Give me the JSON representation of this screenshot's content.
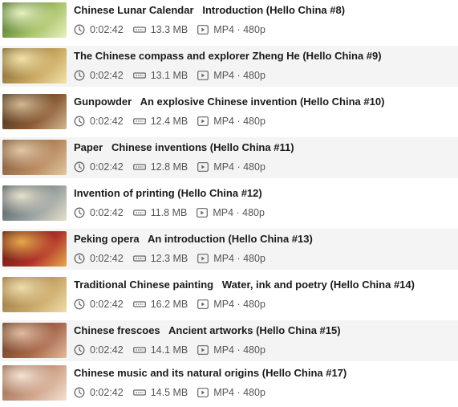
{
  "videos": [
    {
      "title": "Chinese Lunar Calendar   Introduction (Hello China #8)",
      "duration": "0:02:42",
      "size": "13.3 MB",
      "format": "MP4 · 480p",
      "thumb": {
        "c1": "#2f5a1e",
        "c2": "#a9c46a",
        "c3": "#e8f0c0"
      }
    },
    {
      "title": "The Chinese compass and explorer Zheng He (Hello China #9)",
      "duration": "0:02:42",
      "size": "13.1 MB",
      "format": "MP4 · 480p",
      "thumb": {
        "c1": "#6a5228",
        "c2": "#c9a860",
        "c3": "#f2e2a8"
      }
    },
    {
      "title": "Gunpowder   An explosive Chinese invention (Hello China #10)",
      "duration": "0:02:42",
      "size": "12.4 MB",
      "format": "MP4 · 480p",
      "thumb": {
        "c1": "#3a2a1c",
        "c2": "#8a5a34",
        "c3": "#d2b890"
      }
    },
    {
      "title": "Paper   Chinese inventions (Hello China #11)",
      "duration": "0:02:42",
      "size": "12.8 MB",
      "format": "MP4 · 480p",
      "thumb": {
        "c1": "#6b4a30",
        "c2": "#b88960",
        "c3": "#e0c7a2"
      }
    },
    {
      "title": "Invention of printing (Hello China #12)",
      "duration": "0:02:42",
      "size": "11.8 MB",
      "format": "MP4 · 480p",
      "thumb": {
        "c1": "#3d4a55",
        "c2": "#9aa2a0",
        "c3": "#e6e0cc"
      }
    },
    {
      "title": "Peking opera   An introduction (Hello China #13)",
      "duration": "0:02:42",
      "size": "12.3 MB",
      "format": "MP4 · 480p",
      "thumb": {
        "c1": "#4a1410",
        "c2": "#b0322a",
        "c3": "#e8a84c"
      }
    },
    {
      "title": "Traditional Chinese painting   Water, ink and poetry (Hello China #14)",
      "duration": "0:02:42",
      "size": "16.2 MB",
      "format": "MP4 · 480p",
      "thumb": {
        "c1": "#8a6a3a",
        "c2": "#c8a868",
        "c3": "#efdcaa"
      }
    },
    {
      "title": "Chinese frescoes   Ancient artworks (Hello China #15)",
      "duration": "0:02:42",
      "size": "14.1 MB",
      "format": "MP4 · 480p",
      "thumb": {
        "c1": "#5a3020",
        "c2": "#a8684a",
        "c3": "#e0bca0"
      }
    },
    {
      "title": "Chinese music and its natural origins (Hello China #17)",
      "duration": "0:02:42",
      "size": "14.5 MB",
      "format": "MP4 · 480p",
      "thumb": {
        "c1": "#8a5a40",
        "c2": "#d0a48a",
        "c3": "#f4e2d4"
      }
    }
  ],
  "icons": {
    "duration": "clock-icon",
    "size": "file-size-icon",
    "format": "video-play-icon"
  }
}
